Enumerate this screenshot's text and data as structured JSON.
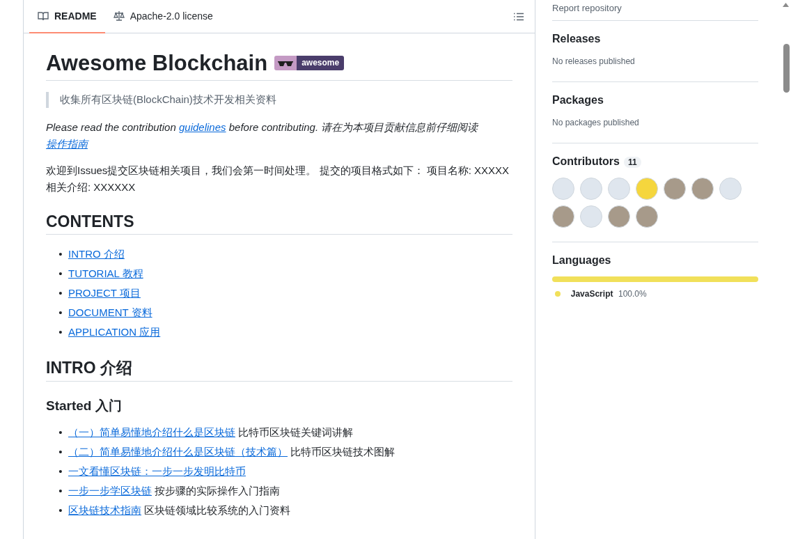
{
  "readme": {
    "tabs": [
      {
        "label": "README",
        "selected": true
      },
      {
        "label": "Apache-2.0 license",
        "selected": false
      }
    ],
    "title": "Awesome Blockchain",
    "badge": "awesome",
    "blocks": [
      {
        "kind": "quote",
        "text": "收集所有区块链(BlockChain)技术开发相关资料"
      },
      {
        "kind": "paragraph",
        "italic": true,
        "segments": [
          {
            "text": "Please read the contribution "
          },
          {
            "link": "guidelines"
          },
          {
            "text": " before contributing. 请在为本项目贡献信息前仔细阅读 "
          },
          {
            "link": "操作指南"
          }
        ]
      },
      {
        "kind": "paragraph",
        "italic": false,
        "segments": [
          {
            "text": "欢迎到Issues提交区块链相关项目，我们会第一时间处理。 提交的项目格式如下： 项目名称: XXXXX 相关介绍: XXXXXX"
          }
        ]
      },
      {
        "kind": "h2",
        "text": "CONTENTS"
      },
      {
        "kind": "list",
        "marker": "•",
        "items": [
          {
            "link": "INTRO 介绍"
          },
          {
            "link": "TUTORIAL 教程"
          },
          {
            "link": "PROJECT 项目"
          },
          {
            "link": "DOCUMENT 资料"
          },
          {
            "link": "APPLICATION 应用"
          }
        ]
      },
      {
        "kind": "h2",
        "text": "INTRO 介绍"
      },
      {
        "kind": "h3",
        "text": "Started 入门"
      },
      {
        "kind": "list",
        "marker": "•",
        "items": [
          {
            "link": "（一）简单易懂地介绍什么是区块链",
            "text": "比特币区块链关键词讲解"
          },
          {
            "link": "（二）简单易懂地介绍什么是区块链（技术篇）",
            "text": "比特币区块链技术图解"
          },
          {
            "link": "一文看懂区块链：一步一步发明比特币"
          },
          {
            "link": "一步一步学区块链",
            "text": "按步骤的实际操作入门指南"
          },
          {
            "link": "区块链技术指南",
            "text": "区块链领域比较系统的入门资料"
          }
        ]
      }
    ]
  },
  "sidebar": {
    "report_link": "Report repository",
    "releases": {
      "title": "Releases",
      "note": "No releases published"
    },
    "packages": {
      "title": "Packages",
      "note": "No packages published"
    },
    "contributors": {
      "title": "Contributors",
      "count": "11",
      "avatars": [
        {
          "kind": "cartoon"
        },
        {
          "kind": "cartoon"
        },
        {
          "kind": "cartoon"
        },
        {
          "kind": "emoji"
        },
        {
          "kind": "photo"
        },
        {
          "kind": "photo"
        },
        {
          "kind": "cartoon"
        },
        {
          "kind": "photo"
        },
        {
          "kind": "cartoon"
        },
        {
          "kind": "photo"
        },
        {
          "kind": "photo"
        }
      ]
    },
    "languages": {
      "title": "Languages",
      "items": [
        {
          "name": "JavaScript",
          "percent": "100.0%",
          "level": 1.0,
          "color": "#f1e05a"
        }
      ]
    }
  }
}
